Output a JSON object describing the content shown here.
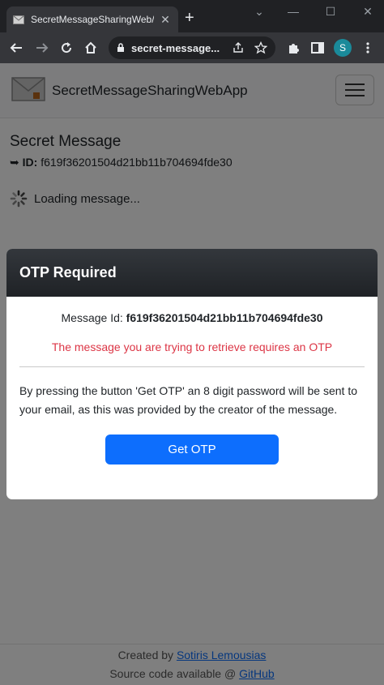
{
  "browser": {
    "tab_title": "SecretMessageSharingWeb/",
    "tab_close": "✕",
    "new_tab": "+",
    "url": "secret-message...",
    "profile_initial": "S",
    "window_controls": [
      "⌄",
      "—",
      "☐",
      "✕"
    ]
  },
  "app": {
    "brand": "SecretMessageSharingWebApp",
    "page_title": "Secret Message",
    "id_arrow": "➥",
    "id_label": "ID:",
    "id_value": "f619f36201504d21bb11b704694fde30",
    "loading_text": "Loading message...",
    "footer": {
      "created_by_prefix": "Created by",
      "author": "Sotiris Lemousias",
      "source_prefix": "Source code available @",
      "source_link": "GitHub"
    }
  },
  "modal": {
    "title": "OTP Required",
    "message_id_label": "Message Id:",
    "message_id_value": "f619f36201504d21bb11b704694fde30",
    "warning": "The message you are trying to retrieve requires an OTP",
    "description": "By pressing the button 'Get OTP' an 8 digit password will be sent to your email, as this was provided by the creator of the message.",
    "button_label": "Get OTP"
  },
  "colors": {
    "primary": "#0d6efd",
    "danger": "#dc3545",
    "modal_header": "#26292d"
  }
}
